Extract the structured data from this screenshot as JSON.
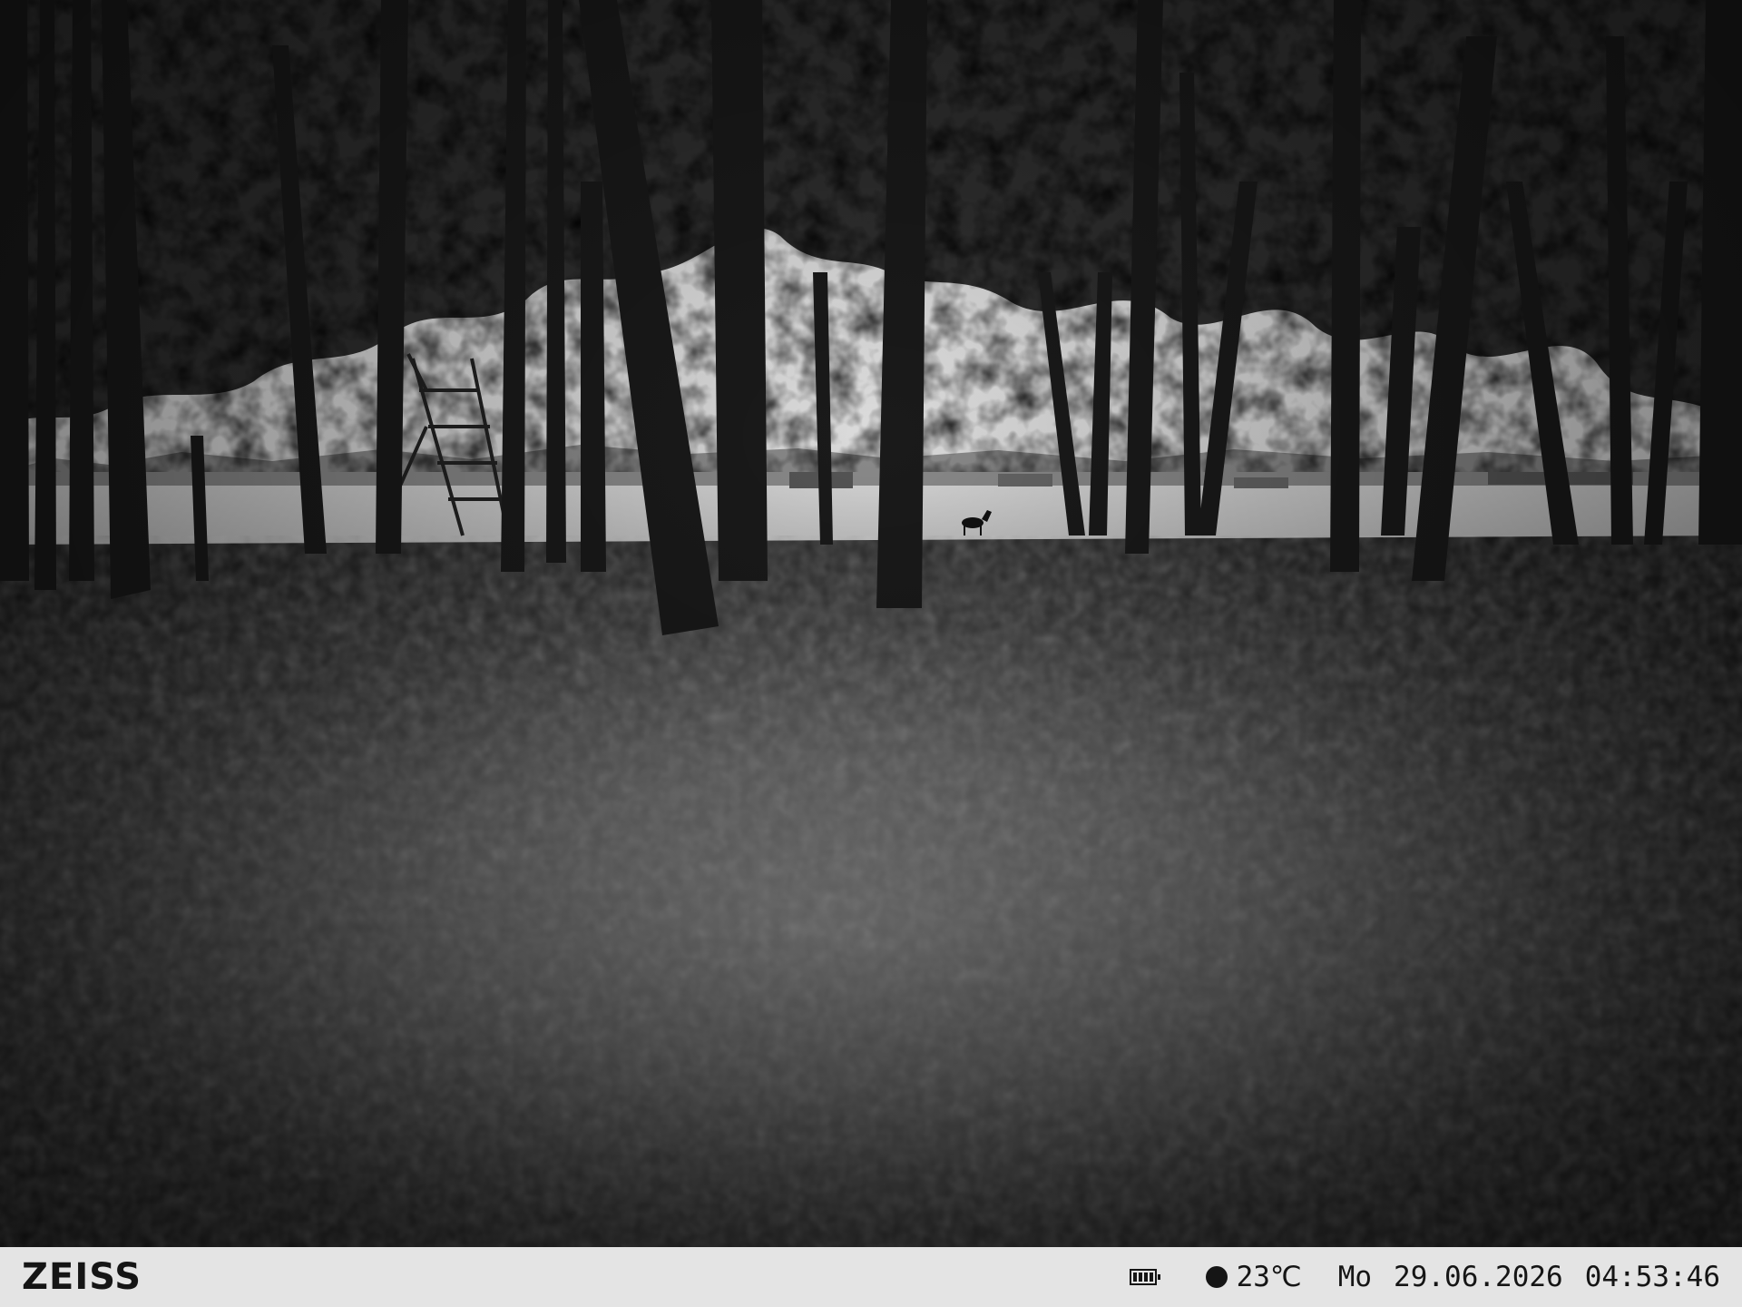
{
  "camera": {
    "brand": "ZEISS",
    "battery_icon": "battery-full-icon",
    "moon_phase_icon": "new-moon-icon",
    "battery_level": 1.0,
    "temperature": "23℃",
    "day": "Mo",
    "date": "29.06.2026",
    "time": "04:53:46"
  },
  "colors": {
    "info_bar_background": "#e4e4e4",
    "info_bar_text": "#151515"
  }
}
